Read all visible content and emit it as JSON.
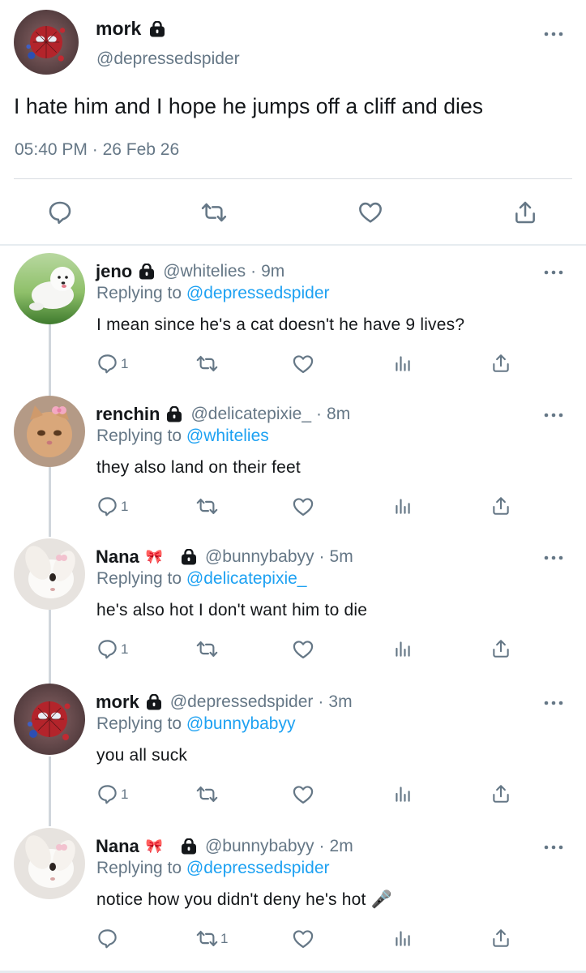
{
  "main_tweet": {
    "name": "mork",
    "handle": "@depressedspider",
    "text": "I hate him and I hope he jumps off a cliff and dies",
    "time": "05:40 PM",
    "date": "26 Feb 26",
    "timestamp_sep": "·"
  },
  "replies": [
    {
      "name": "jeno",
      "handle": "@whitelies",
      "sep": "·",
      "age": "9m",
      "replying_prefix": "Replying to",
      "replying_to": "@depressedspider",
      "text": "I mean since he's a cat doesn't he have 9 lives?",
      "reply_count": "1",
      "retweet_count": "",
      "avatar": "white-dog"
    },
    {
      "name": "renchin",
      "handle": "@delicatepixie_",
      "sep": "·",
      "age": "8m",
      "replying_prefix": "Replying to",
      "replying_to": "@whitelies",
      "text": "they also land on their feet",
      "reply_count": "1",
      "retweet_count": "",
      "avatar": "kitten-with-bow"
    },
    {
      "name": "Nana",
      "name_emoji": "🎀",
      "handle": "@bunnybabyy",
      "sep": "·",
      "age": "5m",
      "replying_prefix": "Replying to",
      "replying_to": "@delicatepixie_",
      "text": "he's also hot I don't want him to die",
      "reply_count": "1",
      "retweet_count": "",
      "avatar": "white-bunny"
    },
    {
      "name": "mork",
      "handle": "@depressedspider",
      "sep": "·",
      "age": "3m",
      "replying_prefix": "Replying to",
      "replying_to": "@bunnybabyy",
      "text": "you all suck",
      "reply_count": "1",
      "retweet_count": "",
      "avatar": "spider-plush"
    },
    {
      "name": "Nana",
      "name_emoji": "🎀",
      "handle": "@bunnybabyy",
      "sep": "·",
      "age": "2m",
      "replying_prefix": "Replying to",
      "replying_to": "@depressedspider",
      "text": "notice how you didn't deny he's hot",
      "text_emoji": "🎤",
      "reply_count": "",
      "retweet_count": "1",
      "avatar": "white-bunny"
    }
  ],
  "icons": {
    "reply": "reply-icon",
    "retweet": "retweet-icon",
    "like": "heart-icon",
    "analytics": "analytics-icon",
    "share": "share-icon",
    "lock": "lock-icon",
    "more": "more-icon"
  },
  "colors": {
    "text": "#14171a",
    "secondary": "#657786",
    "link": "#1da1f2",
    "icon": "#657786"
  }
}
